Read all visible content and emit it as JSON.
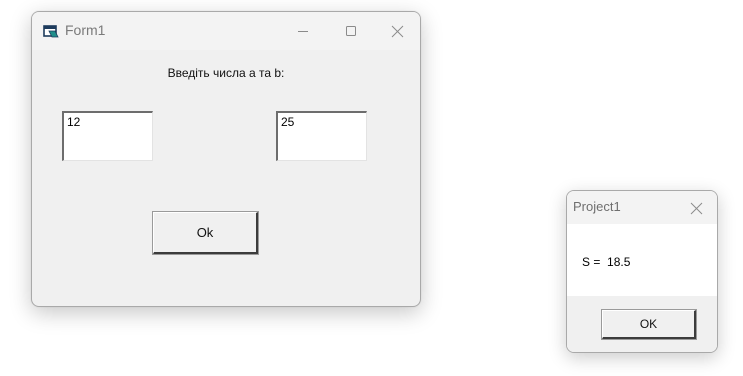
{
  "main_window": {
    "title": "Form1",
    "icon": "form-app-icon",
    "caption_buttons": {
      "minimize_icon": "minimize-icon",
      "maximize_icon": "maximize-icon",
      "close_icon": "close-icon"
    },
    "prompt": "Введіть числа a та b:",
    "input_a": {
      "value": "12"
    },
    "input_b": {
      "value": "25"
    },
    "ok_button_label": "Ok"
  },
  "message_box": {
    "title": "Project1",
    "close_icon": "close-icon",
    "text": "S =  18.5",
    "ok_button_label": "OK"
  },
  "colors": {
    "window_bg": "#f0f0f0",
    "titlebar_bg": "#f3f3f3",
    "text": "#000000",
    "caption_icon": "#8a8a8a"
  }
}
